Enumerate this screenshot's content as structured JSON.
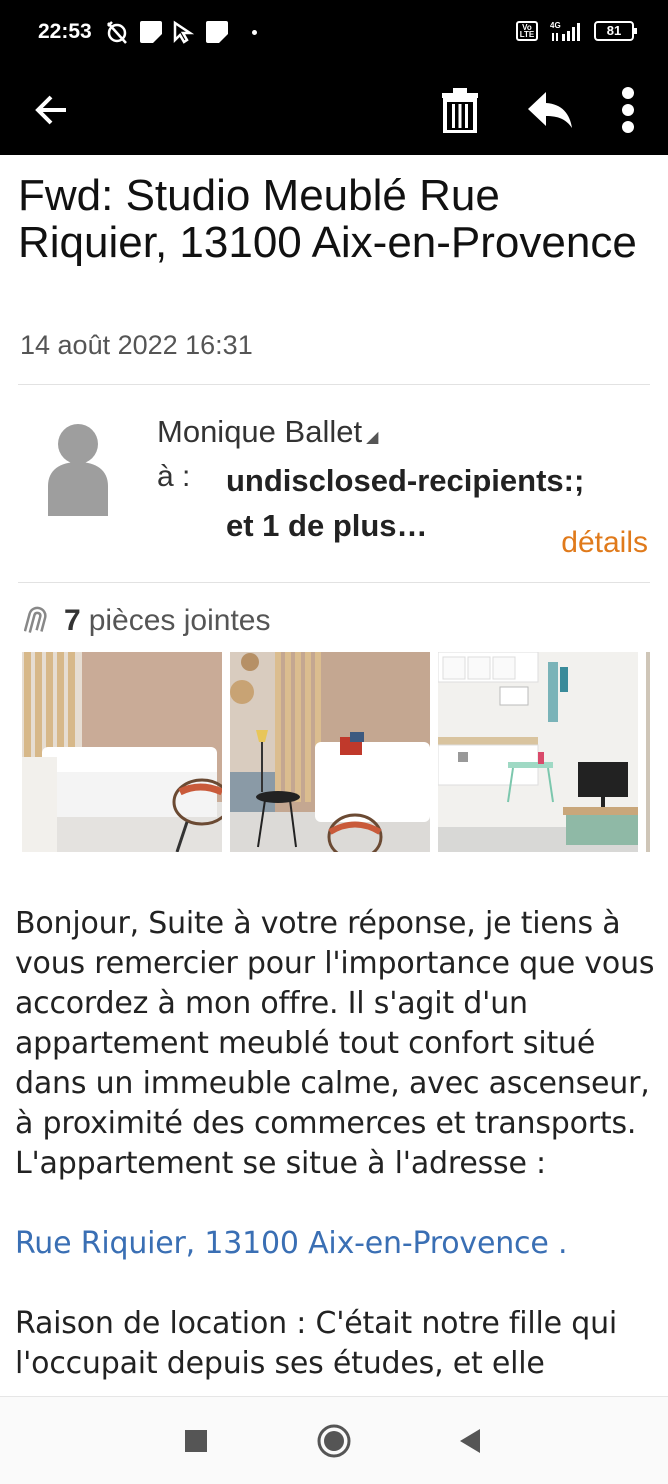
{
  "status_bar": {
    "time": "22:53",
    "network": "4G",
    "battery": "81",
    "volte": "Vo LTE"
  },
  "action_bar": {
    "back_icon": "arrow-left-icon",
    "delete_icon": "trash-icon",
    "reply_icon": "reply-icon",
    "more_icon": "more-vert-icon"
  },
  "email": {
    "subject": "Fwd: Studio Meublé Rue Riquier, 13100 Aix-en-Provence",
    "date": "14 août 2022 16:31",
    "sender": "Monique Ballet",
    "to_label": "à :",
    "to_line1": "undisclosed-recipients:;",
    "to_line2": "et 1 de plus…",
    "details_label": "détails"
  },
  "attachments": {
    "count": "7",
    "label": "pièces jointes",
    "icon": "paperclip-icon"
  },
  "body": {
    "paragraph1": "Bonjour, Suite à votre réponse, je tiens à vous remercier pour l'importance que vous accordez à mon offre. Il s'agit d'un appartement meublé tout confort situé dans un immeuble calme, avec ascenseur, à proximité des commerces et transports. L'appartement se situe à l'adresse :",
    "address_link": "Rue Riquier, 13100 Aix-en-Provence .",
    "paragraph2": "Raison de location : C'était notre fille qui l'occupait depuis ses études, et elle"
  },
  "colors": {
    "accent": "#e07a1b",
    "link": "#3a6fb4",
    "topbar": "#000000"
  }
}
